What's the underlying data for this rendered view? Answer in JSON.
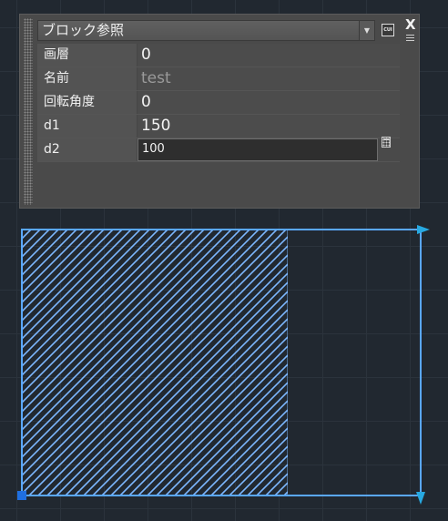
{
  "palette": {
    "block_type": "ブロック参照",
    "cui_label": "CUI",
    "close_label": "X",
    "properties": [
      {
        "label": "画層",
        "value": "0"
      },
      {
        "label": "名前",
        "value": "test"
      },
      {
        "label": "回転角度",
        "value": "0"
      },
      {
        "label": "d1",
        "value": "150"
      },
      {
        "label": "d2",
        "value": "100"
      }
    ]
  },
  "drawing": {
    "hatch_fill_fraction": 0.6667,
    "outline_color": "#4a9dff",
    "grip_color": "#1f6fe0",
    "background_color": "#212830"
  }
}
